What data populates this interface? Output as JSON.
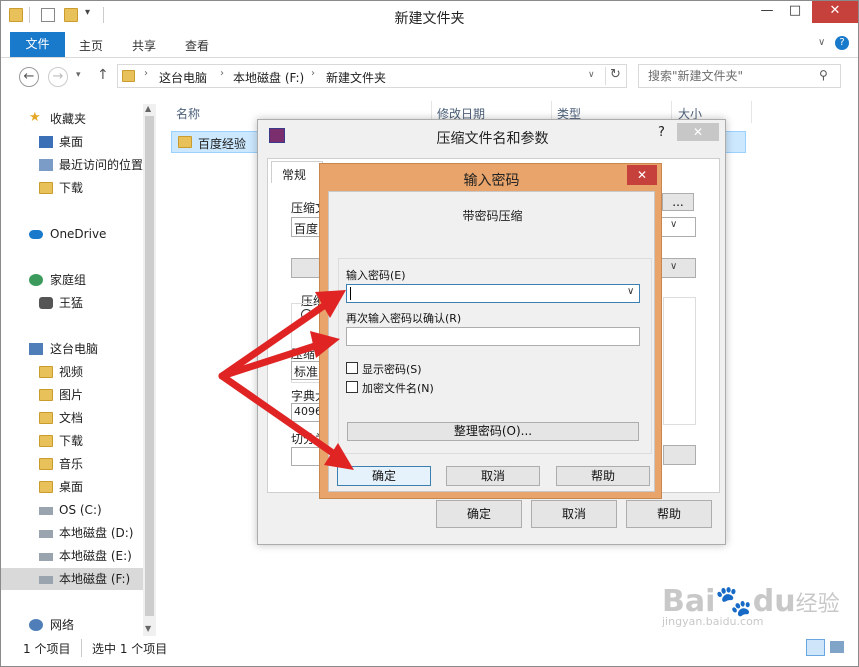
{
  "window": {
    "title": "新建文件夹"
  },
  "ribbon": {
    "tabs": [
      "文件",
      "主页",
      "共享",
      "查看"
    ]
  },
  "address": {
    "path": [
      "这台电脑",
      "本地磁盘 (F:)",
      "新建文件夹"
    ],
    "search_placeholder": "搜索\"新建文件夹\""
  },
  "nav": {
    "favorites": "收藏夹",
    "favorites_items": [
      "桌面",
      "最近访问的位置",
      "下载"
    ],
    "onedrive": "OneDrive",
    "homegroup": "家庭组",
    "homegroup_items": [
      "王猛"
    ],
    "thispc": "这台电脑",
    "thispc_items": [
      "视频",
      "图片",
      "文档",
      "下载",
      "音乐",
      "桌面",
      "OS (C:)",
      "本地磁盘 (D:)",
      "本地磁盘 (E:)",
      "本地磁盘 (F:)"
    ],
    "network": "网络"
  },
  "filelist": {
    "columns": [
      "名称",
      "修改日期",
      "类型",
      "大小"
    ],
    "rows": [
      {
        "name": "百度经验"
      }
    ]
  },
  "status": {
    "count": "1 个项目",
    "selected": "选中 1 个项目"
  },
  "archive_dialog": {
    "title": "压缩文件名和参数",
    "help": "?",
    "tab_general": "常规",
    "partial_labels": [
      "压缩文",
      "百度",
      "压缩",
      "压缩",
      "标准",
      "字典大",
      "4096",
      "切分为"
    ],
    "ok": "确定",
    "cancel": "取消",
    "help_button": "帮助",
    "browse": "..."
  },
  "password_dialog": {
    "title": "输入密码",
    "subtitle": "带密码压缩",
    "enter_label": "输入密码(E)",
    "confirm_label": "再次输入密码以确认(R)",
    "show_password": "显示密码(S)",
    "encrypt_names": "加密文件名(N)",
    "organize": "整理密码(O)...",
    "ok": "确定",
    "cancel": "取消",
    "help": "帮助"
  },
  "watermark": {
    "brand": "Bai",
    "brand2": "du",
    "brand3": "经验",
    "url": "jingyan.baidu.com"
  },
  "colors": {
    "accent": "#1979ca",
    "dialog_frame": "#e8a46a",
    "close_red": "#c7413c",
    "arrow_red": "#e02424"
  }
}
